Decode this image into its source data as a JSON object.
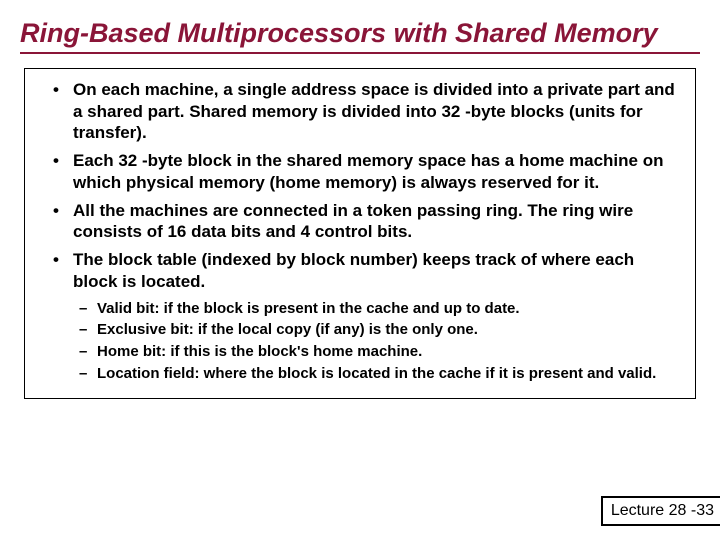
{
  "title": "Ring-Based Multiprocessors with Shared Memory",
  "bullets": [
    "On each machine, a single address space is divided into a private part and a shared part. Shared memory is divided into 32 -byte blocks (units for transfer).",
    "Each 32 -byte block in the shared memory space has a home machine on which physical memory (home memory) is always reserved for it.",
    "All the machines are connected in a token passing ring.  The ring wire consists of 16 data bits and 4 control bits.",
    "The block table (indexed by block number) keeps track of where each block is located."
  ],
  "subbullets": [
    "Valid bit: if the block is present in the cache and up to date.",
    "Exclusive bit: if the local copy (if any) is the only one.",
    "Home bit: if this is the block's home machine.",
    "Location field: where the block is located in the cache if it is present and valid."
  ],
  "footer": "Lecture 28 -33"
}
